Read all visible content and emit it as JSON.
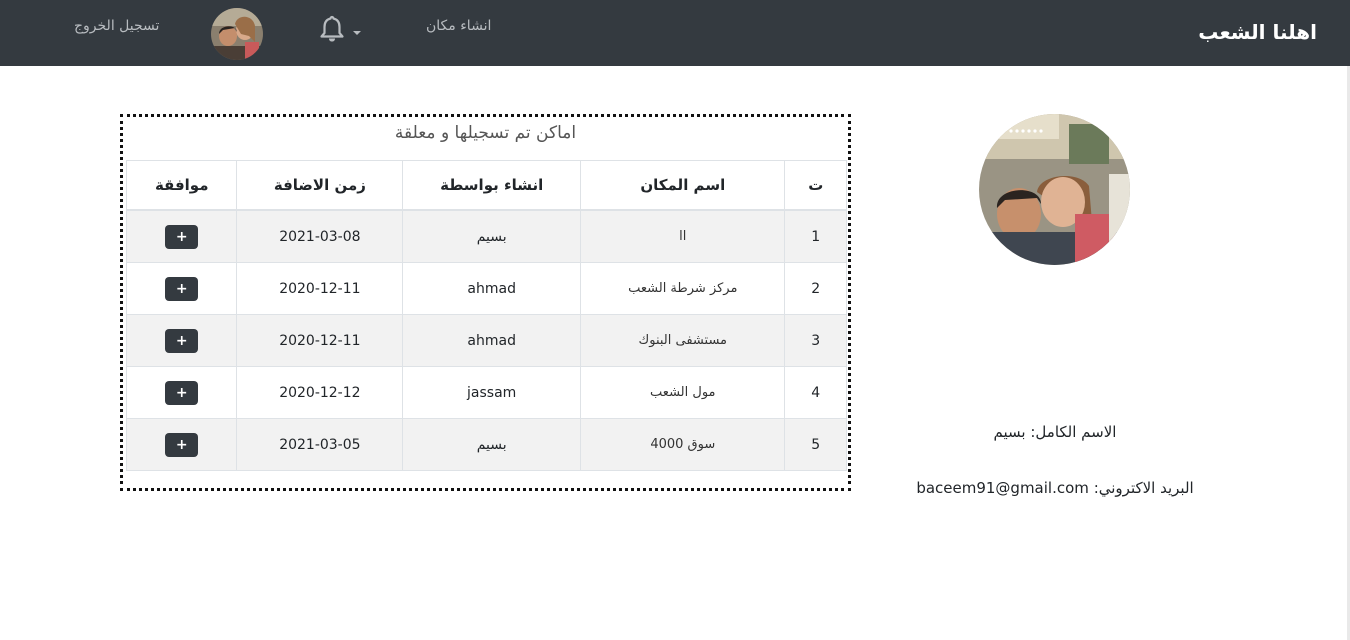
{
  "navbar": {
    "brand": "اهلنا الشعب",
    "create_place": "انشاء مكان",
    "logout": "تسجيل الخروج"
  },
  "profile": {
    "full_name_label": "الاسم الكامل:",
    "full_name": "بسيم",
    "email_label": "البريد الاكتروني:",
    "email": "baceem91@gmail.com"
  },
  "table": {
    "caption": "اماكن تم تسجيلها و معلقة",
    "headers": {
      "num": "ت",
      "name": "اسم المكان",
      "created_by": "انشاء بواسطة",
      "added_time": "زمن الاضافة",
      "approve": "موافقة"
    },
    "approve_label": "+",
    "rows": [
      {
        "num": "1",
        "name": "ll",
        "created_by": "بسيم",
        "added_time": "2021-03-08"
      },
      {
        "num": "2",
        "name": "مركز شرطة الشعب",
        "created_by": "ahmad",
        "added_time": "2020-12-11"
      },
      {
        "num": "3",
        "name": "مستشفى البنوك",
        "created_by": "ahmad",
        "added_time": "2020-12-11"
      },
      {
        "num": "4",
        "name": "مول الشعب",
        "created_by": "jassam",
        "added_time": "2020-12-12"
      },
      {
        "num": "5",
        "name": "سوق 4000",
        "created_by": "بسيم",
        "added_time": "2021-03-05"
      }
    ]
  }
}
